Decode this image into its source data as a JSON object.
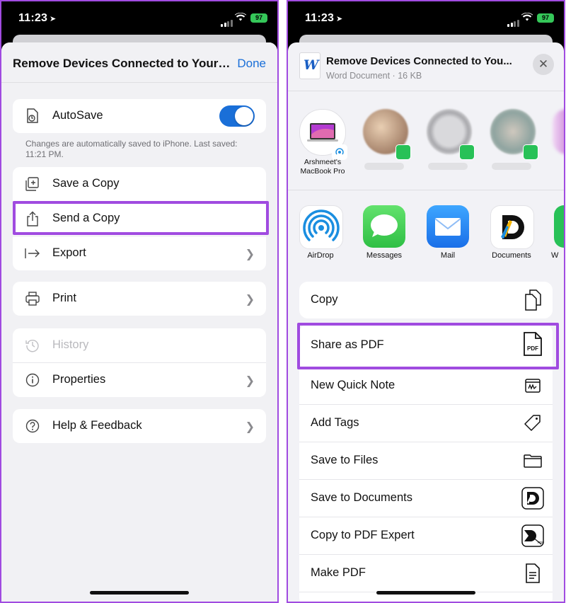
{
  "status": {
    "time": "11:23",
    "battery": "97"
  },
  "left": {
    "header": {
      "title": "Remove Devices Connected to Your I...",
      "done": "Done"
    },
    "autosave": {
      "label": "AutoSave",
      "hint": "Changes are automatically saved to iPhone. Last saved: 11:21 PM."
    },
    "group1": [
      {
        "label": "Save a Copy"
      },
      {
        "label": "Send a Copy"
      },
      {
        "label": "Export"
      }
    ],
    "print": {
      "label": "Print"
    },
    "group3": [
      {
        "label": "History"
      },
      {
        "label": "Properties"
      }
    ],
    "help": {
      "label": "Help & Feedback"
    }
  },
  "right": {
    "doc": {
      "title": "Remove Devices Connected to You...",
      "subtitle": "Word Document · 16 KB",
      "type_letter": "W"
    },
    "people": [
      {
        "line1": "Arshmeet's",
        "line2": "MacBook Pro"
      }
    ],
    "apps": [
      {
        "label": "AirDrop"
      },
      {
        "label": "Messages"
      },
      {
        "label": "Mail"
      },
      {
        "label": "Documents"
      },
      {
        "label": "W"
      }
    ],
    "actions": [
      {
        "label": "Copy",
        "icon": "copy-icon"
      },
      {
        "label": "Share as PDF",
        "icon": "pdf-icon"
      },
      {
        "label": "New Quick Note",
        "icon": "quick-note-icon"
      },
      {
        "label": "Add Tags",
        "icon": "tag-icon"
      },
      {
        "label": "Save to Files",
        "icon": "folder-icon"
      },
      {
        "label": "Save to Documents",
        "icon": "documents-app-icon"
      },
      {
        "label": "Copy to PDF Expert",
        "icon": "pdf-expert-icon"
      },
      {
        "label": "Make PDF",
        "icon": "make-pdf-icon"
      }
    ],
    "pdf_badge": "PDF"
  },
  "colors": {
    "accent": "#1a6fd8",
    "highlight": "#a04be0",
    "whatsapp": "#28c157"
  }
}
